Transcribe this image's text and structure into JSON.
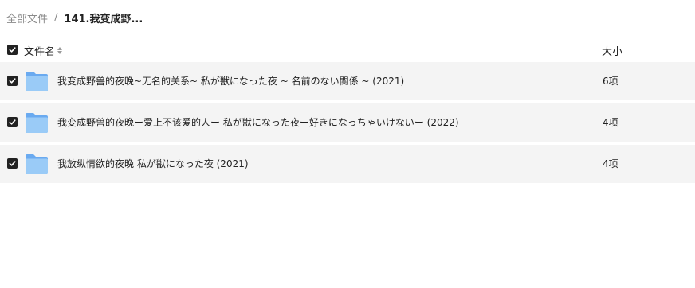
{
  "breadcrumb": {
    "root": "全部文件",
    "separator": "/",
    "current": "141.我变成野..."
  },
  "table": {
    "header": {
      "name_label": "文件名",
      "size_label": "大小",
      "select_all_checked": true
    },
    "rows": [
      {
        "icon": "folder-icon",
        "name": "我变成野兽的夜晚~无名的关系~ 私が獣になった夜 ~ 名前のない関係 ~ (2021)",
        "size": "6项",
        "checked": true
      },
      {
        "icon": "folder-icon",
        "name": "我变成野兽的夜晚ー爱上不该爱的人ー 私が獣になった夜ー好きになっちゃいけないー (2022)",
        "size": "4项",
        "checked": true
      },
      {
        "icon": "folder-icon",
        "name": "我放纵情欲的夜晚 私が獣になった夜 (2021)",
        "size": "4项",
        "checked": true
      }
    ]
  },
  "colors": {
    "row_background": "#f4f4f4",
    "checkbox_fill": "#222222",
    "folder_blue": "#7fb8ee",
    "muted_text": "#8a8a8a"
  }
}
